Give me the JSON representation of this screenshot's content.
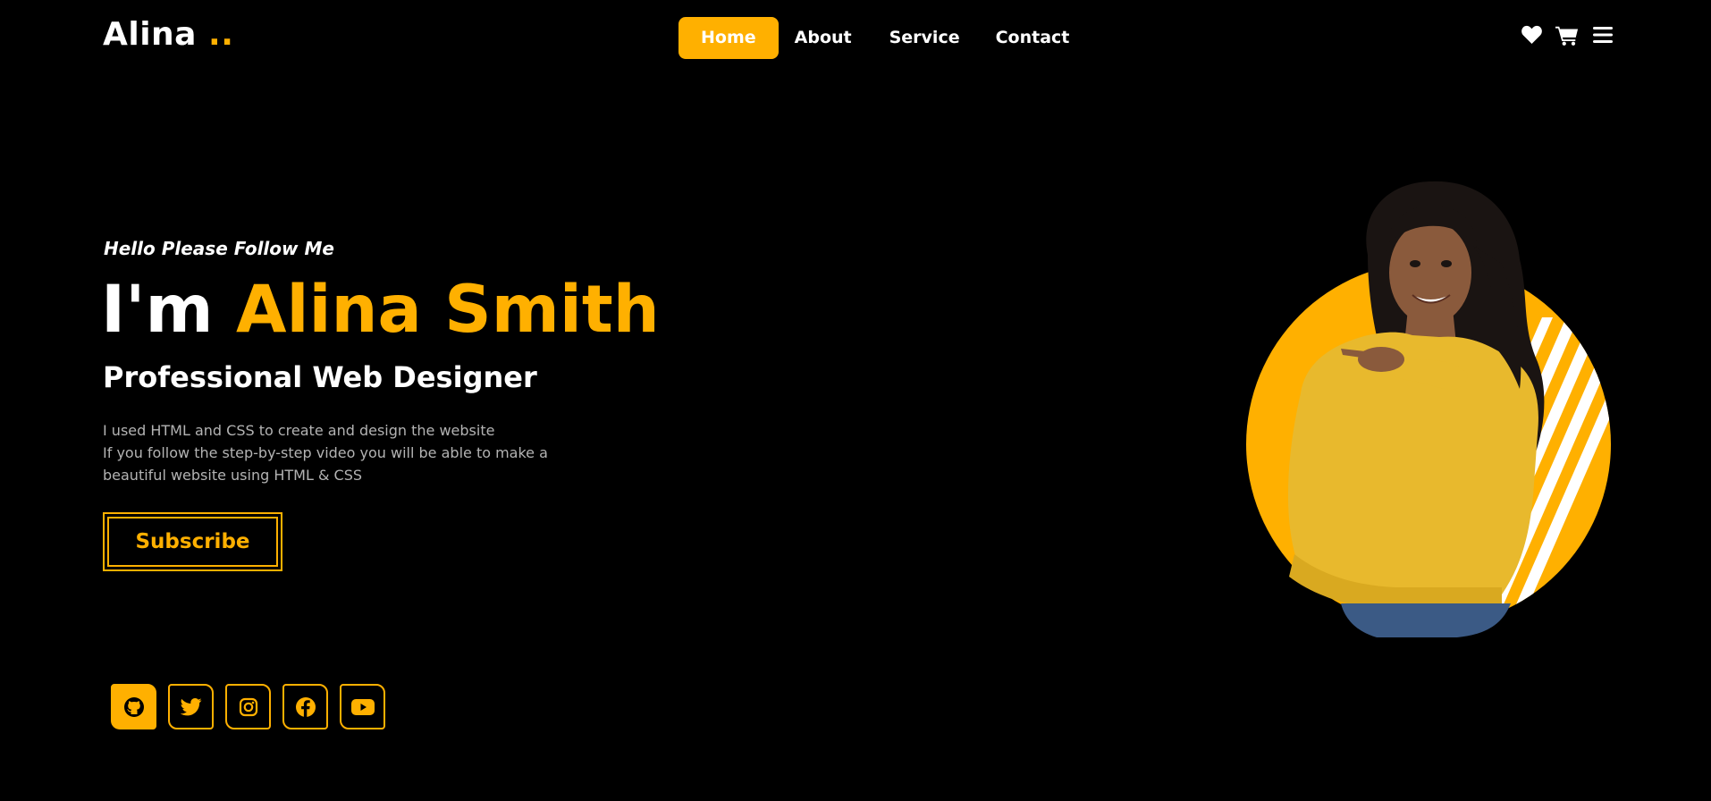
{
  "header": {
    "logo_text": "Alina",
    "logo_dots": "..",
    "nav": [
      {
        "label": "Home",
        "active": true
      },
      {
        "label": "About",
        "active": false
      },
      {
        "label": "Service",
        "active": false
      },
      {
        "label": "Contact",
        "active": false
      }
    ],
    "icons": [
      "heart-icon",
      "cart-icon",
      "menu-icon"
    ]
  },
  "hero": {
    "greeting": "Hello Please Follow Me",
    "title_prefix": "I'm",
    "title_name": "Alina Smith",
    "subtitle": "Professional Web Designer",
    "description_lines": [
      "I used HTML and CSS to create and design the website",
      "If you follow the step-by-step video you will be able to make a",
      "beautiful website using HTML & CSS"
    ],
    "subscribe_label": "Subscribe"
  },
  "social": [
    "github-icon",
    "twitter-icon",
    "instagram-icon",
    "facebook-icon",
    "youtube-icon"
  ],
  "colors": {
    "accent": "#ffb000",
    "background": "#000000",
    "text": "#ffffff",
    "muted": "#b3b3b3",
    "sweater": "#e8b92d"
  }
}
